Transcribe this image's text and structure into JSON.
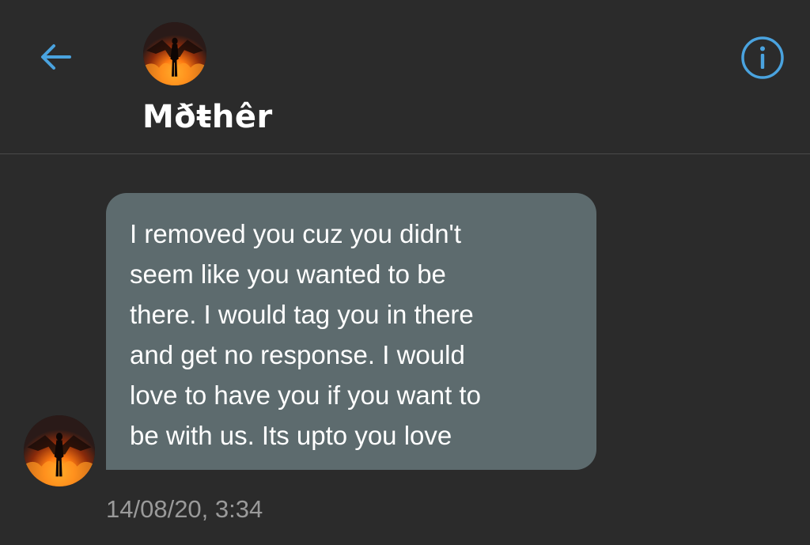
{
  "header": {
    "contact_name": "Mðŧhêr",
    "back_icon": "arrow-left-icon",
    "info_icon": "info-circle-icon",
    "avatar_icon": "winged-figure-fire-avatar"
  },
  "messages": [
    {
      "sender": "Mðŧhêr",
      "text": "I removed you cuz you didn't\nseem like you wanted to be\nthere. I would tag you in there\nand get no response. I would\nlove to have you if you want to\nbe with us. Its upto you love",
      "timestamp": "14/08/20, 3:34"
    }
  ],
  "colors": {
    "background": "#2b2b2b",
    "bubble": "#5d6b6e",
    "accent": "#4aa3df",
    "timestamp": "#9a9a9a",
    "text": "#ffffff"
  }
}
